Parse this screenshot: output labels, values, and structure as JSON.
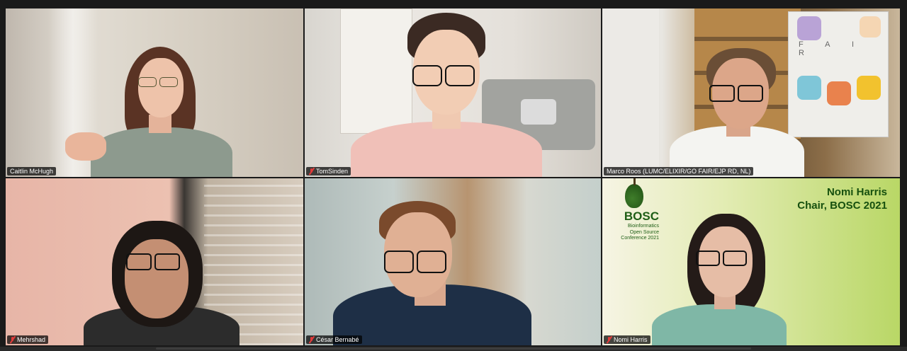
{
  "gallery": {
    "tiles": [
      {
        "name": "Caitlin McHugh",
        "muted": false,
        "active": true
      },
      {
        "name": "TomSinden",
        "muted": true,
        "active": false
      },
      {
        "name": "Marco Roos (LUMC/ELIXIR/GO FAIR/EJP RD, NL)",
        "muted": false,
        "active": false
      },
      {
        "name": "Mehrshad",
        "muted": true,
        "active": false
      },
      {
        "name": "César Bernabé",
        "muted": true,
        "active": false
      },
      {
        "name": "Nomi Harris",
        "muted": true,
        "active": false
      }
    ]
  },
  "slide": {
    "title_line1": "Nomi Harris",
    "title_line2": "Chair, BOSC 2021",
    "logo_word": "BOSC",
    "logo_sub1": "Bioinformatics",
    "logo_sub2": "Open Source",
    "logo_sub3": "Conference 2021"
  },
  "poster": {
    "letters": "F A I R"
  }
}
